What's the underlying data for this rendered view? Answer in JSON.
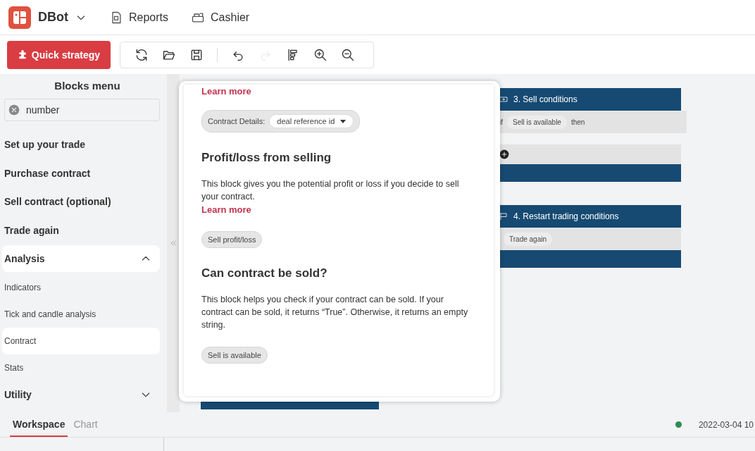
{
  "app": {
    "name": "DBot"
  },
  "nav": [
    {
      "kind": "reports",
      "label": "Reports"
    },
    {
      "kind": "cashier",
      "label": "Cashier"
    }
  ],
  "toolbar": {
    "quick_strategy": "Quick strategy",
    "buttons": [
      {
        "kind": "reset",
        "disabled": false
      },
      {
        "kind": "open",
        "disabled": false
      },
      {
        "kind": "save",
        "disabled": false
      },
      {
        "kind": "divider"
      },
      {
        "kind": "undo",
        "disabled": false
      },
      {
        "kind": "redo",
        "disabled": true
      },
      {
        "kind": "arrange",
        "disabled": false
      },
      {
        "kind": "zoom-in",
        "disabled": false
      },
      {
        "kind": "zoom-out",
        "disabled": false
      }
    ]
  },
  "blocks_menu": {
    "title": "Blocks menu",
    "search": {
      "value": "number"
    },
    "categories": [
      {
        "label": "Set up your trade",
        "kind": "plain",
        "selected": false
      },
      {
        "label": "Purchase contract",
        "kind": "plain",
        "selected": false
      },
      {
        "label": "Sell contract (optional)",
        "kind": "plain",
        "selected": false
      },
      {
        "label": "Trade again",
        "kind": "plain",
        "selected": false
      },
      {
        "label": "Analysis",
        "kind": "expandable",
        "expanded": true,
        "selected": true,
        "children": [
          {
            "label": "Indicators",
            "selected": false
          },
          {
            "label": "Tick and candle analysis",
            "selected": false
          },
          {
            "label": "Contract",
            "selected": true
          },
          {
            "label": "Stats",
            "selected": false
          }
        ]
      },
      {
        "label": "Utility",
        "kind": "expandable",
        "expanded": false,
        "selected": false
      }
    ]
  },
  "help": {
    "sections": [
      {
        "link": "Learn more",
        "block": {
          "kind": "dropdown",
          "label": "Contract Details:",
          "value": "deal reference id"
        }
      },
      {
        "title": "Profit/loss from selling",
        "text": "This block gives you the potential profit or loss if you decide to sell your contract.",
        "link": "Learn more",
        "block": {
          "kind": "plain",
          "label": "Sell profit/loss"
        }
      },
      {
        "title": "Can contract be sold?",
        "text": "This block helps you check if your contract can be sold. If your contract can be sold, it returns “True”. Otherwise, it returns an empty string.",
        "block": {
          "kind": "plain",
          "label": "Sell is available"
        }
      }
    ]
  },
  "workspace": {
    "blocks": [
      {
        "kind": "sell",
        "title": "3. Sell conditions",
        "if": "if",
        "condition": "Sell is available",
        "then": "then"
      },
      {
        "kind": "restart",
        "title": "4. Restart trading conditions",
        "statement": "Trade again"
      }
    ]
  },
  "bottom_tabs": [
    {
      "label": "Workspace",
      "selected": true
    },
    {
      "label": "Chart",
      "selected": false
    }
  ],
  "status": {
    "color": "#2e8b57",
    "time": "2022-03-04 10"
  }
}
